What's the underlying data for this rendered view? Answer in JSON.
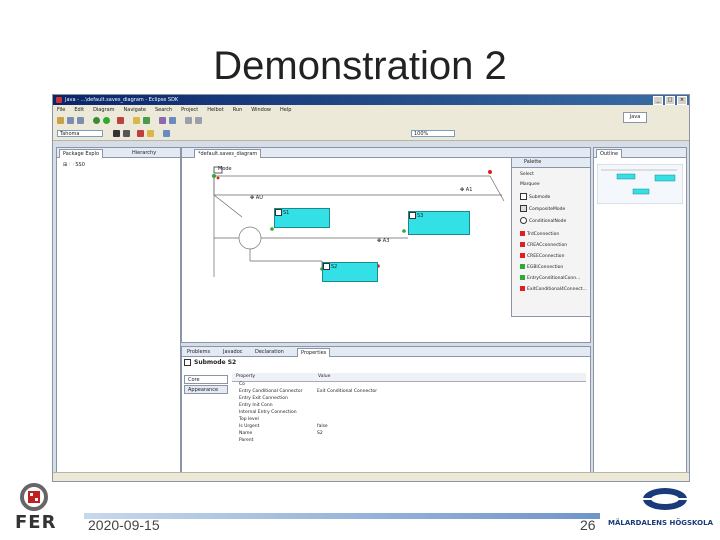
{
  "slide": {
    "title": "Demonstration 2",
    "date": "2020-09-15",
    "page_number": "26",
    "fer_logo_text": "FER",
    "mdh_logo_text": "MÄLARDALENS HÖGSKOLA"
  },
  "window": {
    "title": "Java - ...\\default.saves_diagram - Eclipse SDK"
  },
  "menubar": [
    "File",
    "Edit",
    "Diagram",
    "Navigate",
    "Search",
    "Project",
    "Helbot",
    "Run",
    "Window",
    "Help"
  ],
  "toolbar": {
    "font_select": "Tahoma",
    "zoom_select": "100%",
    "perspective": "Java"
  },
  "left_panel": {
    "tabs": [
      "Package Explo",
      "Hierarchy"
    ],
    "tree": [
      "⊞ 🗀 SS0"
    ]
  },
  "editor": {
    "tab": "*default.saves_diagram",
    "mode_label": "Mode",
    "labels": [
      "AU",
      "A1",
      "A3",
      "S1",
      "S2",
      "S3"
    ]
  },
  "palette": {
    "title": "Palette",
    "items": [
      "Select",
      "Marquee",
      "Submode",
      "CompositeMode",
      "ConditionalNode",
      "TrdConnection",
      "CREACconnection",
      "CREEConnection",
      "EGBIConnection",
      "EntryConditionalConn...",
      "ExitConditional4Connect..."
    ]
  },
  "outline": {
    "tab": "Outline"
  },
  "bottom_panel": {
    "tabs": [
      "Problems",
      "Javadoc",
      "Declaration",
      "Properties"
    ],
    "header": "Submode S2",
    "side_tabs": [
      "Core",
      "Appearance"
    ],
    "columns": [
      "Property",
      "Value"
    ],
    "rows": [
      {
        "property": "Co",
        "value": ""
      },
      {
        "property": "Entry Conditional Connector",
        "value": "Exit Conditional Connector"
      },
      {
        "property": "Entry Exit Connection",
        "value": ""
      },
      {
        "property": "Entry Init Conn",
        "value": ""
      },
      {
        "property": "Internal Entry Connection",
        "value": ""
      },
      {
        "property": "Top level",
        "value": ""
      },
      {
        "property": "Is Urgent",
        "value": "false"
      },
      {
        "property": "Name",
        "value": "S2"
      },
      {
        "property": "Parent",
        "value": ""
      }
    ]
  },
  "colors": {
    "node_fill": "#33e0e6",
    "accent_green": "#2eaa2e",
    "accent_red": "#e02020",
    "title_bar": "#0a246a"
  }
}
